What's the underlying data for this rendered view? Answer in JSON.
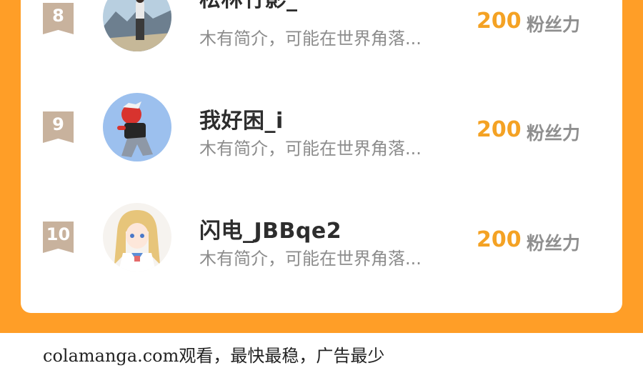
{
  "ranking": {
    "rows": [
      {
        "rank": "8",
        "name": "松林竹影_",
        "bio": "木有简介，可能在世界角落...",
        "score": "200",
        "unit": "粉丝力",
        "avatar_icon": "avatar-photo-mountain-icon"
      },
      {
        "rank": "9",
        "name": "我好困_i",
        "bio": "木有简介，可能在世界角落...",
        "score": "200",
        "unit": "粉丝力",
        "avatar_icon": "avatar-anime-red-demon-icon"
      },
      {
        "rank": "10",
        "name": "闪电_JBBqe2",
        "bio": "木有简介，可能在世界角落...",
        "score": "200",
        "unit": "粉丝力",
        "avatar_icon": "avatar-anime-blonde-girl-icon"
      }
    ]
  },
  "footer": {
    "text": "colamanga.com观看，最快最稳，广告最少"
  },
  "colors": {
    "background_orange": "#ff9e27",
    "score_orange": "#f4a224",
    "rank_badge": "#c8b29d"
  }
}
